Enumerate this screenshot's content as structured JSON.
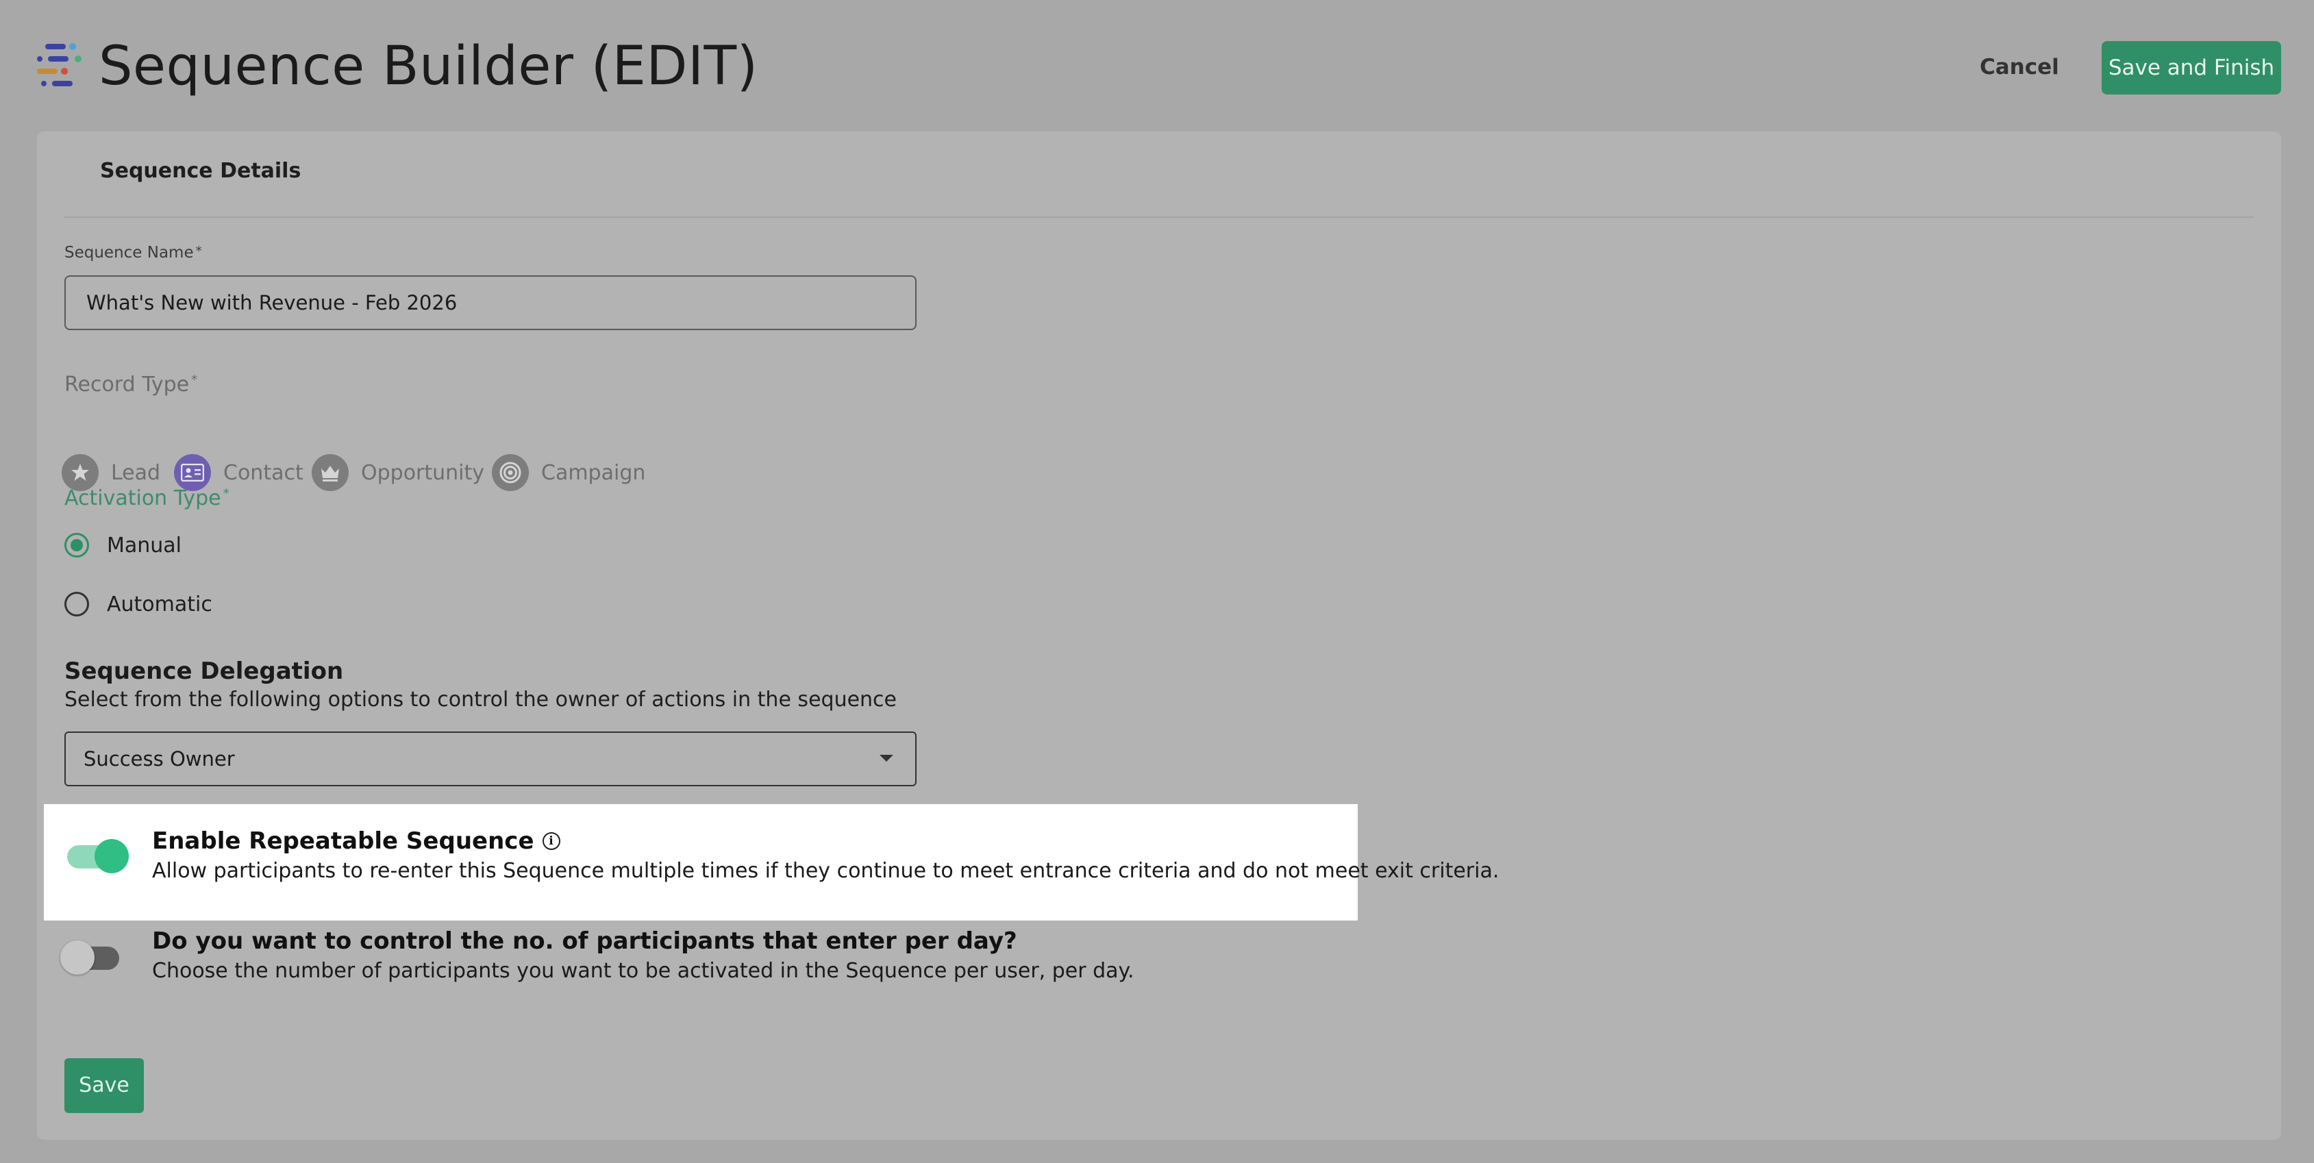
{
  "header": {
    "logo_icon": "sequence-logo-icon",
    "title": "Sequence Builder (EDIT)",
    "cancel_label": "Cancel",
    "save_finish_label": "Save and Finish"
  },
  "details": {
    "section_title": "Sequence Details",
    "name_label": "Sequence Name",
    "required_mark": "*",
    "name_value": "What's New with Revenue - Feb 2026",
    "record_type_label": "Record Type",
    "record_types": [
      {
        "label": "Lead",
        "icon": "lead-icon"
      },
      {
        "label": "Contact",
        "icon": "contact-card-icon",
        "selected": true
      },
      {
        "label": "Opportunity",
        "icon": "crown-icon"
      },
      {
        "label": "Campaign",
        "icon": "target-icon"
      }
    ],
    "activation_label": "Activation Type",
    "activation_options": [
      {
        "label": "Manual",
        "checked": true
      },
      {
        "label": "Automatic",
        "checked": false
      }
    ],
    "delegation_title": "Sequence Delegation",
    "delegation_desc": "Select from the following options to control the owner of actions in the sequence",
    "delegation_value": "Success Owner",
    "repeatable_title": "Enable Repeatable Sequence",
    "repeatable_desc": "Allow participants to re-enter this Sequence multiple times if they continue to meet entrance criteria and do not meet exit criteria.",
    "repeatable_enabled": true,
    "limit_title": "Do you want to control the no. of participants that enter per day?",
    "limit_desc": "Choose the number of participants you want to be activated in the Sequence per user, per day.",
    "limit_enabled": false,
    "save_label": "Save"
  },
  "colors": {
    "primary": "#2f8f66",
    "toggle_on": "#2fbf85",
    "contact_selected": "#6f5fb0"
  }
}
